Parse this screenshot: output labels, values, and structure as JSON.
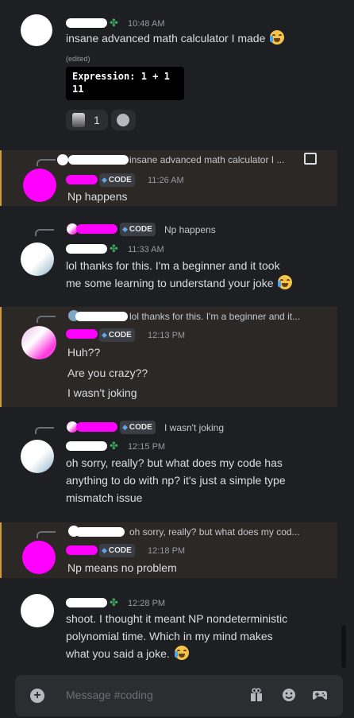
{
  "messages": [
    {
      "time": "10:48 AM",
      "text": "insane advanced math calculator I made",
      "edited": "(edited)",
      "code_lines": [
        "Expression: 1 + 1",
        "11"
      ],
      "reaction_count": "1"
    },
    {
      "reply_text": "insane advanced math calculator I ...",
      "badge": "CODE",
      "time": "11:26 AM",
      "text": "Np happens"
    },
    {
      "reply_badge": "CODE",
      "reply_text": "Np happens",
      "time": "11:33 AM",
      "lines": [
        "lol thanks for this. I'm a beginner and it took",
        "me some learning to understand your joke"
      ]
    },
    {
      "reply_text": "lol thanks for this. I'm a beginner and it...",
      "badge": "CODE",
      "time": "12:13 PM",
      "lines": [
        "Huh??",
        "Are you crazy??",
        "I wasn't joking"
      ]
    },
    {
      "reply_badge": "CODE",
      "reply_text": "I wasn't joking",
      "time": "12:15 PM",
      "lines": [
        "oh sorry, really? but what does my code has",
        "anything to do with np? it's just a simple type",
        "mismatch issue"
      ]
    },
    {
      "reply_text": "oh sorry, really? but what does my cod...",
      "badge": "CODE",
      "time": "12:18 PM",
      "text": "Np means no problem"
    },
    {
      "time": "12:28 PM",
      "lines": [
        "shoot. I thought it meant NP nondeterministic",
        "polynomial time. Which in my mind makes",
        "what you said a joke."
      ]
    }
  ],
  "input": {
    "placeholder": "Message #coding"
  },
  "icons": {
    "add": "add-circle-icon",
    "gift": "gift-icon",
    "emoji": "emoji-icon",
    "game": "gamepad-icon",
    "role": "clover-icon",
    "image": "image-icon",
    "badge": "water-drop-icon"
  },
  "colors": {
    "background": "#1e1f22",
    "mention_bg": "#2b2825",
    "mention_bar": "#c89a3c",
    "badge_drop": "#5fa8e8"
  }
}
